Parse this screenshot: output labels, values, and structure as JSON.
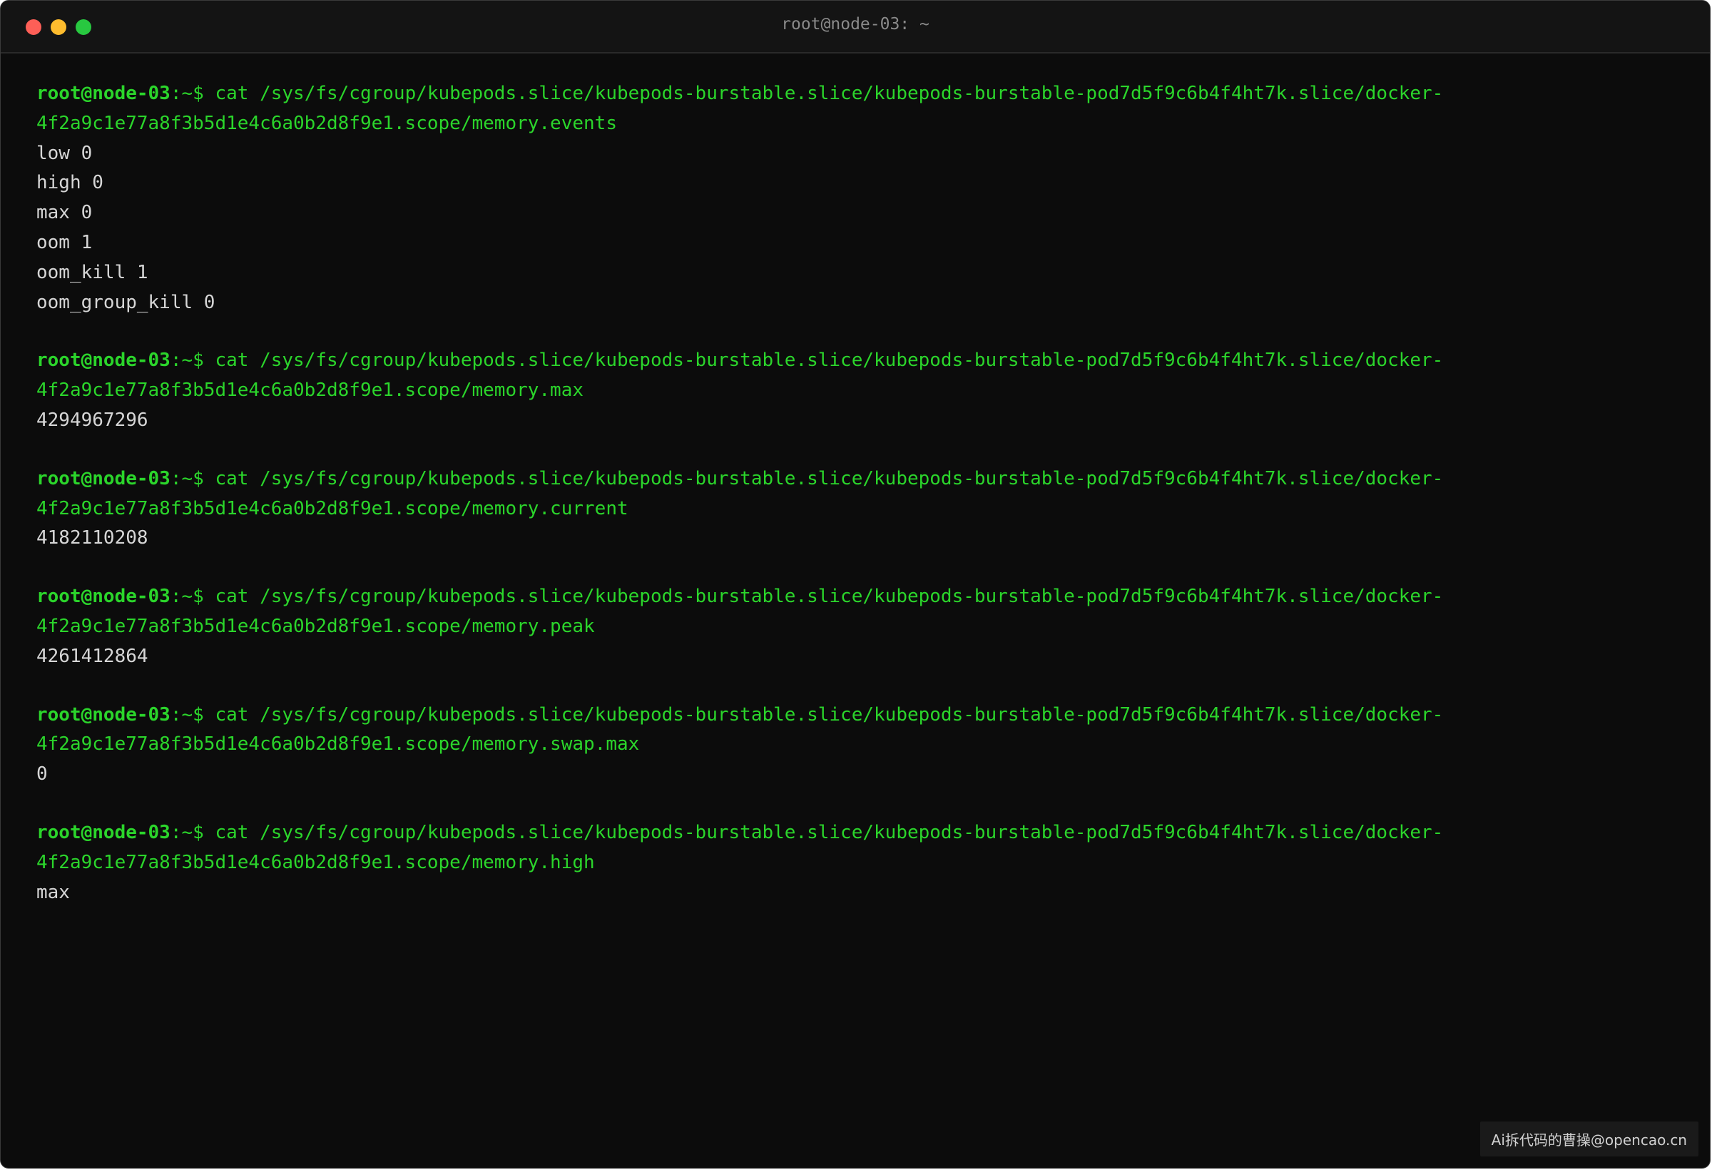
{
  "window": {
    "title": "root@node-03: ~"
  },
  "prompt": {
    "user_host": "root@node-03",
    "suffix": ":~$"
  },
  "blocks": [
    {
      "cmd_line1": " cat /sys/fs/cgroup/kubepods.slice/kubepods-burstable.slice/kubepods-burstable-pod7d5f9c6b4f4ht7k.slice/docker-",
      "cmd_line2": "4f2a9c1e77a8f3b5d1e4c6a0b2d8f9e1.scope/memory.events",
      "output": [
        "low 0",
        "high 0",
        "max 0",
        "oom 1",
        "oom_kill 1",
        "oom_group_kill 0"
      ]
    },
    {
      "cmd_line1": " cat /sys/fs/cgroup/kubepods.slice/kubepods-burstable.slice/kubepods-burstable-pod7d5f9c6b4f4ht7k.slice/docker-",
      "cmd_line2": "4f2a9c1e77a8f3b5d1e4c6a0b2d8f9e1.scope/memory.max",
      "output": [
        "4294967296"
      ]
    },
    {
      "cmd_line1": " cat /sys/fs/cgroup/kubepods.slice/kubepods-burstable.slice/kubepods-burstable-pod7d5f9c6b4f4ht7k.slice/docker-",
      "cmd_line2": "4f2a9c1e77a8f3b5d1e4c6a0b2d8f9e1.scope/memory.current",
      "output": [
        "4182110208"
      ]
    },
    {
      "cmd_line1": " cat /sys/fs/cgroup/kubepods.slice/kubepods-burstable.slice/kubepods-burstable-pod7d5f9c6b4f4ht7k.slice/docker-",
      "cmd_line2": "4f2a9c1e77a8f3b5d1e4c6a0b2d8f9e1.scope/memory.peak",
      "output": [
        "4261412864"
      ]
    },
    {
      "cmd_line1": " cat /sys/fs/cgroup/kubepods.slice/kubepods-burstable.slice/kubepods-burstable-pod7d5f9c6b4f4ht7k.slice/docker-",
      "cmd_line2": "4f2a9c1e77a8f3b5d1e4c6a0b2d8f9e1.scope/memory.swap.max",
      "output": [
        "0"
      ]
    },
    {
      "cmd_line1": " cat /sys/fs/cgroup/kubepods.slice/kubepods-burstable.slice/kubepods-burstable-pod7d5f9c6b4f4ht7k.slice/docker-",
      "cmd_line2": "4f2a9c1e77a8f3b5d1e4c6a0b2d8f9e1.scope/memory.high",
      "output": [
        "max"
      ]
    }
  ],
  "watermark": "Ai拆代码的曹操@opencao.cn",
  "colors": {
    "background": "#0c0c0c",
    "prompt_green": "#2bd52b",
    "output_text": "#d6d6d6",
    "traffic_red": "#fe5f57",
    "traffic_yellow": "#febc2e",
    "traffic_green": "#28c840"
  }
}
